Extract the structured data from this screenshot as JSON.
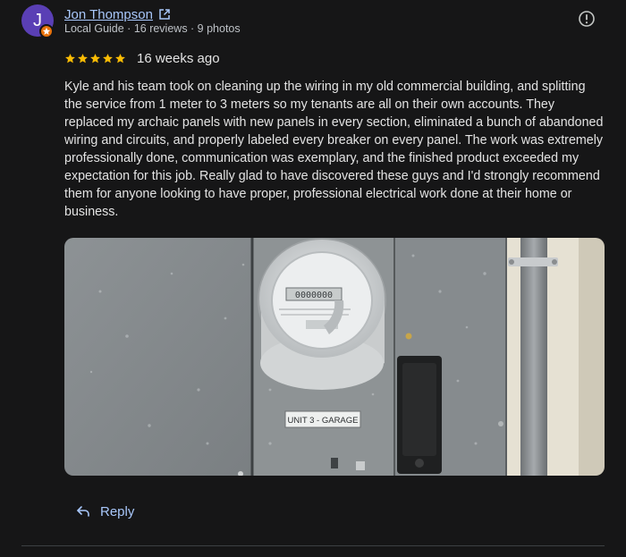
{
  "review": {
    "author": {
      "initial": "J",
      "name": "Jon Thompson",
      "meta": "Local Guide · 16 reviews · 9 photos"
    },
    "rating": 5,
    "time": "16 weeks ago",
    "text": "Kyle and his team took on cleaning up the wiring in my old commercial building, and splitting the service from 1 meter to 3 meters so my tenants are all on their own accounts. They replaced my archaic panels with new panels in every section, eliminated a bunch of abandoned wiring and circuits, and properly labeled every breaker on every panel. The work was extremely professionally done, communication was exemplary, and the finished product exceeded my expectation for this job. Really glad to have discovered these guys and I'd strongly recommend them for anyone looking to have proper, professional electrical work done at their home or business.",
    "photo": {
      "label": "UNIT 3 - GARAGE",
      "meter_reading": "0000000"
    },
    "reply_label": "Reply"
  },
  "colors": {
    "background": "#161617",
    "link": "#a8c7fa",
    "avatar": "#5a3fb5",
    "star": "#fbbc04",
    "badge": "#e8710a"
  },
  "icons": [
    "external-link-icon",
    "report-icon",
    "star-icon",
    "reply-icon",
    "local-guide-badge-icon"
  ]
}
